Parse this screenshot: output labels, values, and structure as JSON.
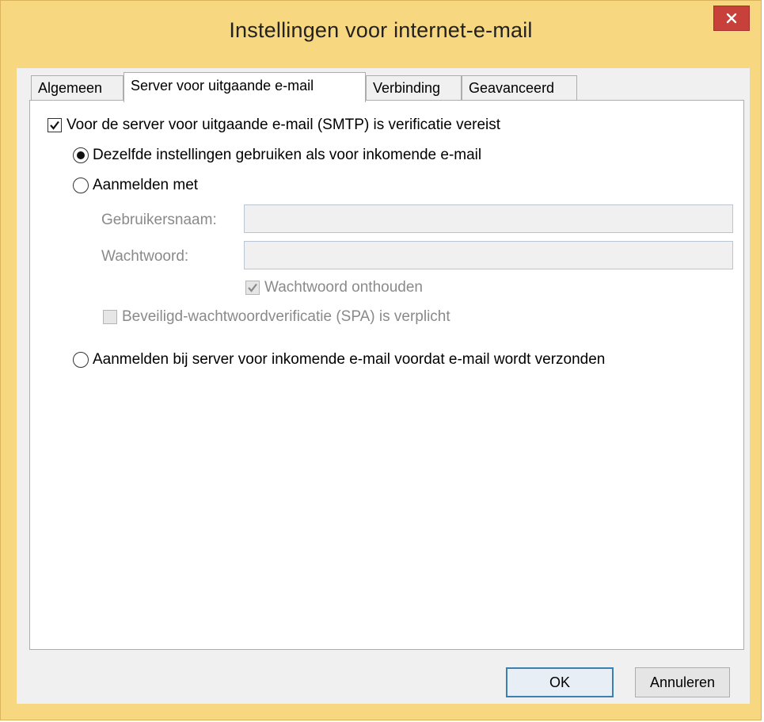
{
  "window": {
    "title": "Instellingen voor internet-e-mail",
    "close_icon": "close-icon"
  },
  "tabs": [
    {
      "label": "Algemeen",
      "active": false
    },
    {
      "label": "Server voor uitgaande e-mail",
      "active": true
    },
    {
      "label": "Verbinding",
      "active": false
    },
    {
      "label": "Geavanceerd",
      "active": false
    }
  ],
  "smtp": {
    "requires_auth_label": "Voor de server voor uitgaande e-mail (SMTP) is verificatie vereist",
    "requires_auth_checked": true,
    "option_same_label": "Dezelfde instellingen gebruiken als voor inkomende e-mail",
    "option_same_selected": true,
    "option_login_label": "Aanmelden met",
    "option_login_selected": false,
    "username_label": "Gebruikersnaam:",
    "username_value": "",
    "password_label": "Wachtwoord:",
    "password_value": "",
    "remember_password_label": "Wachtwoord onthouden",
    "remember_password_checked": true,
    "spa_label": "Beveiligd-wachtwoordverificatie (SPA) is verplicht",
    "spa_checked": false,
    "option_incoming_first_label": "Aanmelden bij server voor inkomende e-mail voordat e-mail wordt verzonden",
    "option_incoming_first_selected": false
  },
  "buttons": {
    "ok": "OK",
    "cancel": "Annuleren"
  },
  "colors": {
    "frame": "#f7d77f",
    "close": "#c7403a"
  }
}
